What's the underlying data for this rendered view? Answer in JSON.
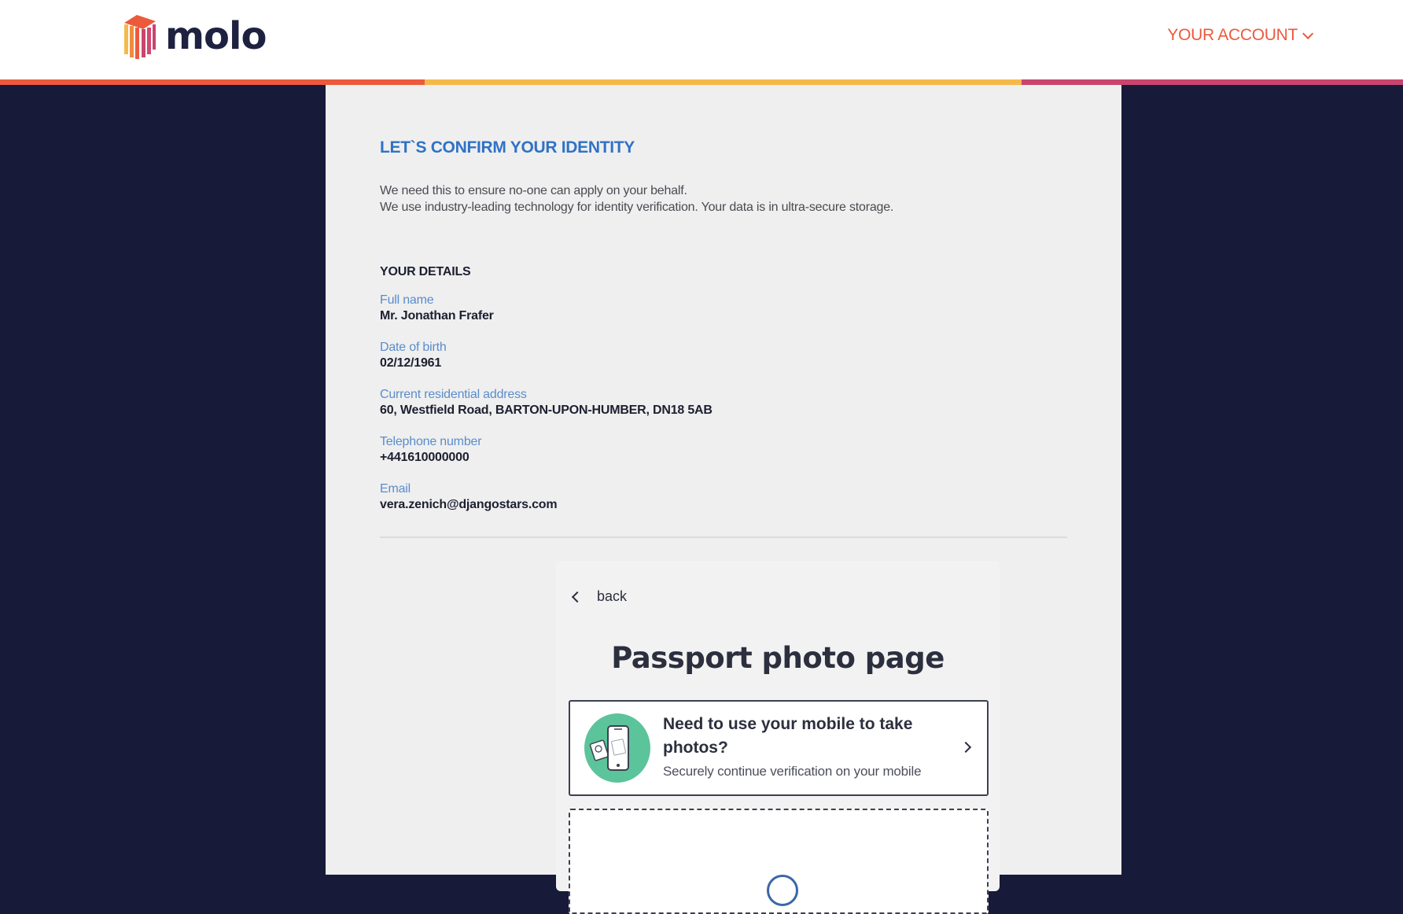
{
  "header": {
    "logo_text": "molo",
    "account_label": "YOUR ACCOUNT"
  },
  "colors": {
    "stripe_orange": "#ec5a3c",
    "stripe_yellow": "#f5b94b",
    "stripe_pink": "#c9456e",
    "accent_blue": "#2f72c6",
    "navy_bg": "#171a38"
  },
  "page": {
    "title": "LET`S CONFIRM YOUR IDENTITY",
    "intro_line1": "We need this to ensure no-one can apply on your behalf.",
    "intro_line2": "We use industry-leading technology for identity verification. Your data is in ultra-secure storage."
  },
  "details": {
    "heading": "YOUR DETAILS",
    "fields": [
      {
        "label": "Full name",
        "value": "Mr. Jonathan Frafer"
      },
      {
        "label": "Date of birth",
        "value": "02/12/1961"
      },
      {
        "label": "Current residential address",
        "value": "60, Westfield Road, BARTON-UPON-HUMBER, DN18 5AB"
      },
      {
        "label": "Telephone number",
        "value": "+441610000000"
      },
      {
        "label": "Email",
        "value": "vera.zenich@djangostars.com"
      }
    ]
  },
  "verification": {
    "back_label": "back",
    "title": "Passport photo page",
    "mobile_title": "Need to use your mobile to take photos?",
    "mobile_subtitle": "Securely continue verification on your mobile",
    "icons": {
      "back": "chevron-left-icon",
      "mobile": "mobile-phone-icon",
      "forward": "chevron-right-icon",
      "account_dropdown": "chevron-down-icon"
    }
  }
}
